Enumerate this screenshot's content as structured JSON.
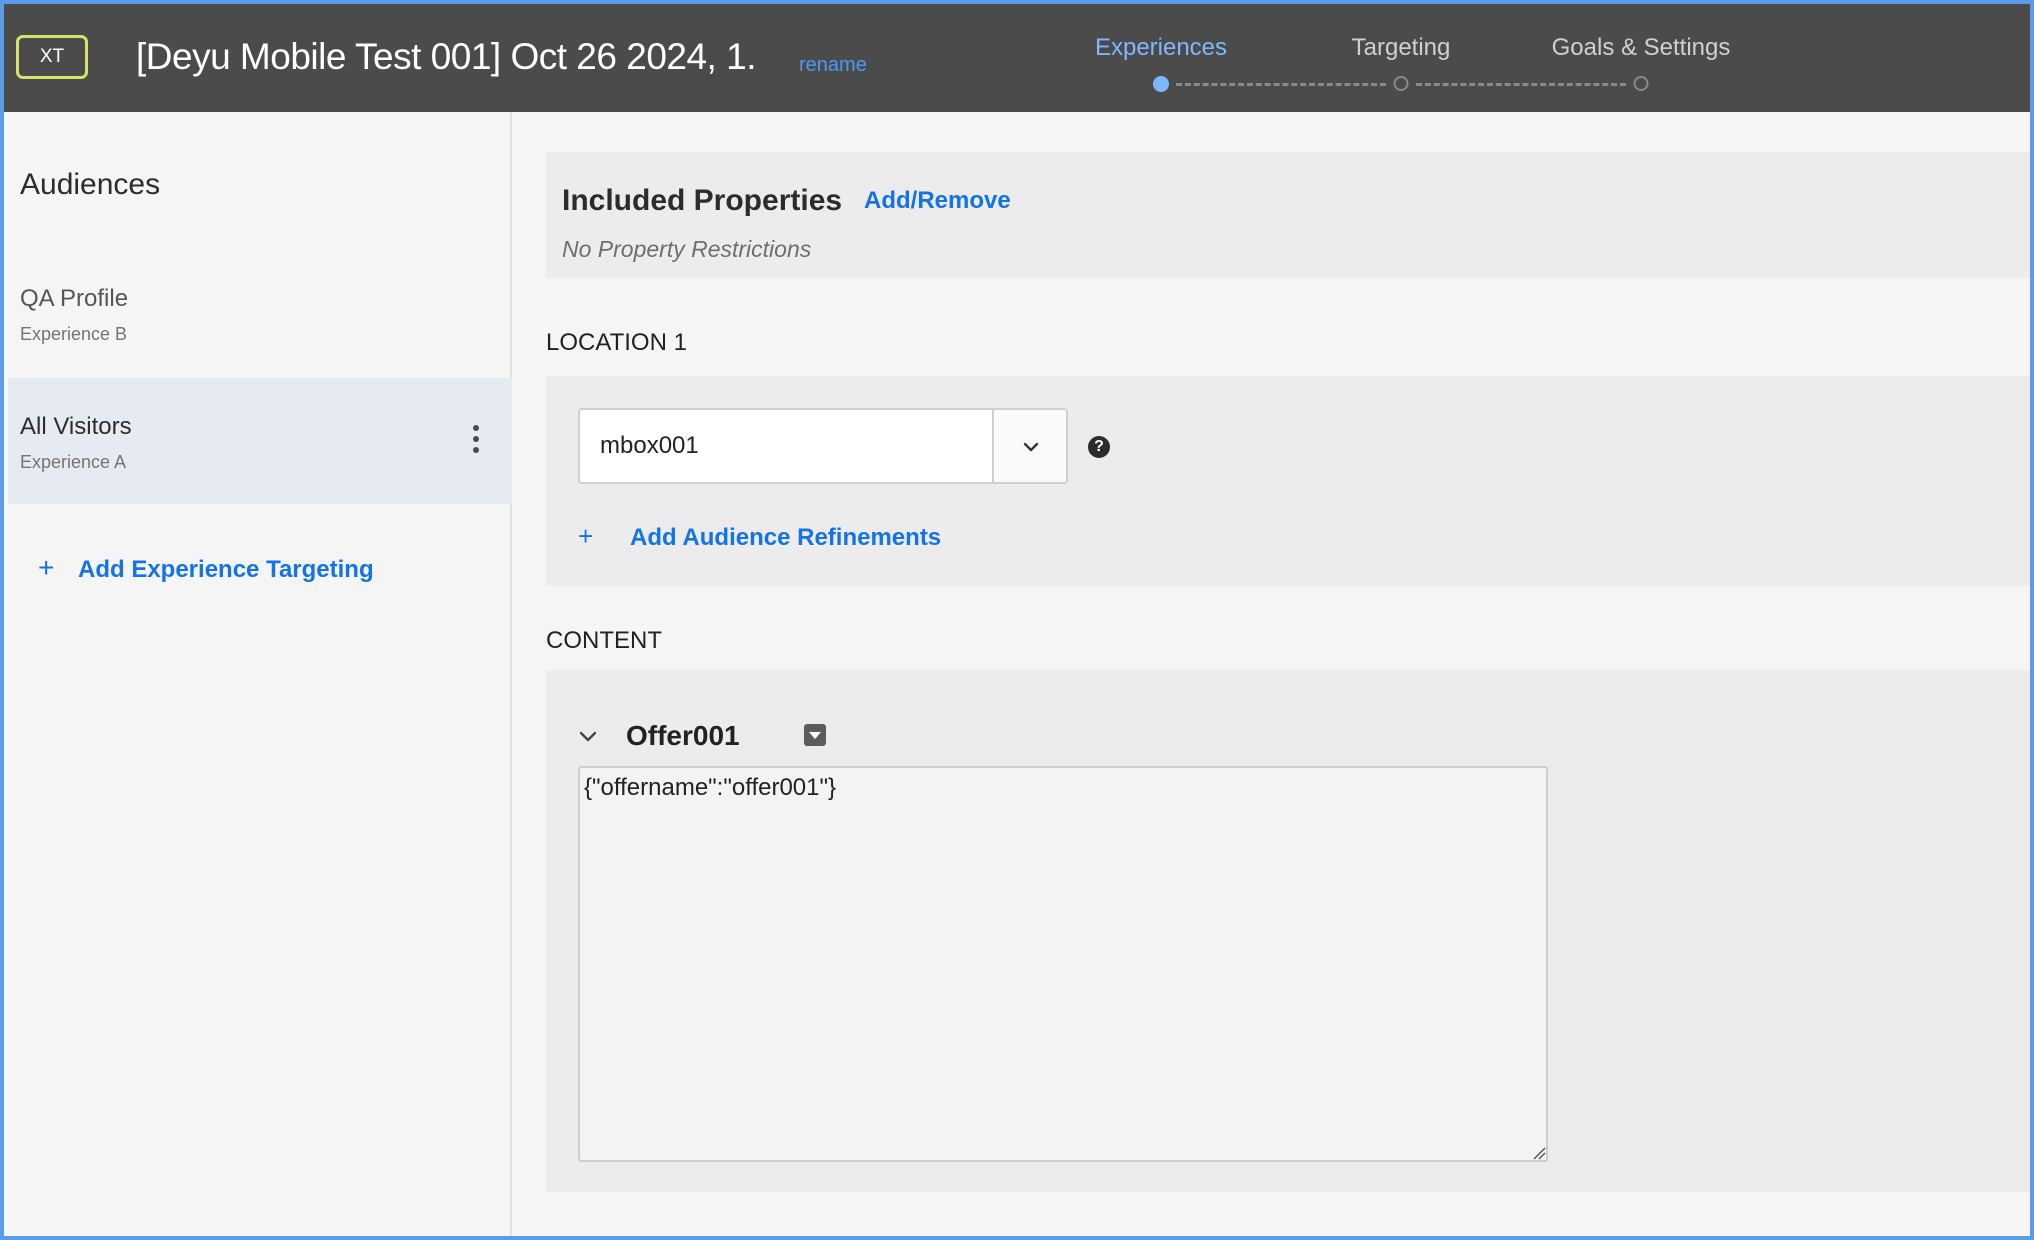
{
  "header": {
    "badge": "XT",
    "title": "[Deyu Mobile Test 001] Oct 26 2024, 1...",
    "rename_label": "rename",
    "steps": [
      {
        "label": "Experiences",
        "active": true
      },
      {
        "label": "Targeting",
        "active": false
      },
      {
        "label": "Goals & Settings",
        "active": false
      }
    ]
  },
  "sidebar": {
    "heading": "Audiences",
    "items": [
      {
        "name": "QA Profile",
        "experience": "Experience B",
        "selected": false
      },
      {
        "name": "All Visitors",
        "experience": "Experience A",
        "selected": true
      }
    ],
    "add_label": "Add Experience Targeting",
    "add_icon": "plus-icon"
  },
  "properties": {
    "title": "Included Properties",
    "action_label": "Add/Remove",
    "status": "No Property Restrictions"
  },
  "location": {
    "section_label": "LOCATION 1",
    "mbox_value": "mbox001",
    "help_icon": "help-icon",
    "refine_label": "Add Audience Refinements"
  },
  "content": {
    "section_label": "CONTENT",
    "offer_name": "Offer001",
    "offer_body": "{\"offername\":\"offer001\"}"
  },
  "colors": {
    "header_bg": "#4b4b4b",
    "accent": "#1473e6",
    "step_active": "#7fb7ff",
    "badge_border": "#d8e36a",
    "selected_row": "#e6ebf2",
    "frame_border": "#5b9bea"
  }
}
